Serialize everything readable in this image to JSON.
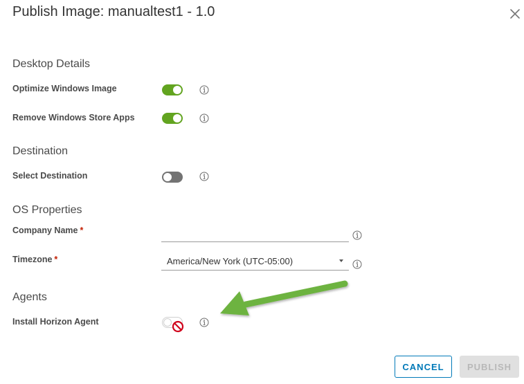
{
  "dialog": {
    "title": "Publish Image: manualtest1 - 1.0",
    "close_icon": "close-icon"
  },
  "sections": {
    "desktop_details": "Desktop Details",
    "destination": "Destination",
    "os_properties": "OS Properties",
    "agents": "Agents"
  },
  "fields": {
    "optimize_windows_image": {
      "label": "Optimize Windows Image",
      "enabled": true
    },
    "remove_windows_store_apps": {
      "label": "Remove Windows Store Apps",
      "enabled": true
    },
    "select_destination": {
      "label": "Select Destination",
      "enabled": false
    },
    "company_name": {
      "label": "Company Name",
      "required_marker": "*",
      "value": "",
      "placeholder": ""
    },
    "timezone": {
      "label": "Timezone",
      "required_marker": "*",
      "selected": "America/New York (UTC-05:00)"
    },
    "install_horizon_agent": {
      "label": "Install Horizon Agent",
      "enabled": false,
      "disabled": true
    }
  },
  "footer": {
    "cancel_label": "CANCEL",
    "publish_label": "PUBLISH"
  },
  "colors": {
    "toggle_on": "#62a420",
    "toggle_off": "#737373",
    "primary": "#0079b8",
    "required": "#c21d00",
    "annotation_arrow": "#6db33f",
    "not_allowed": "#d0021b"
  },
  "icons": [
    "close-icon",
    "info-icon",
    "chevron-down-icon",
    "not-allowed-icon",
    "arrow-annotation"
  ]
}
